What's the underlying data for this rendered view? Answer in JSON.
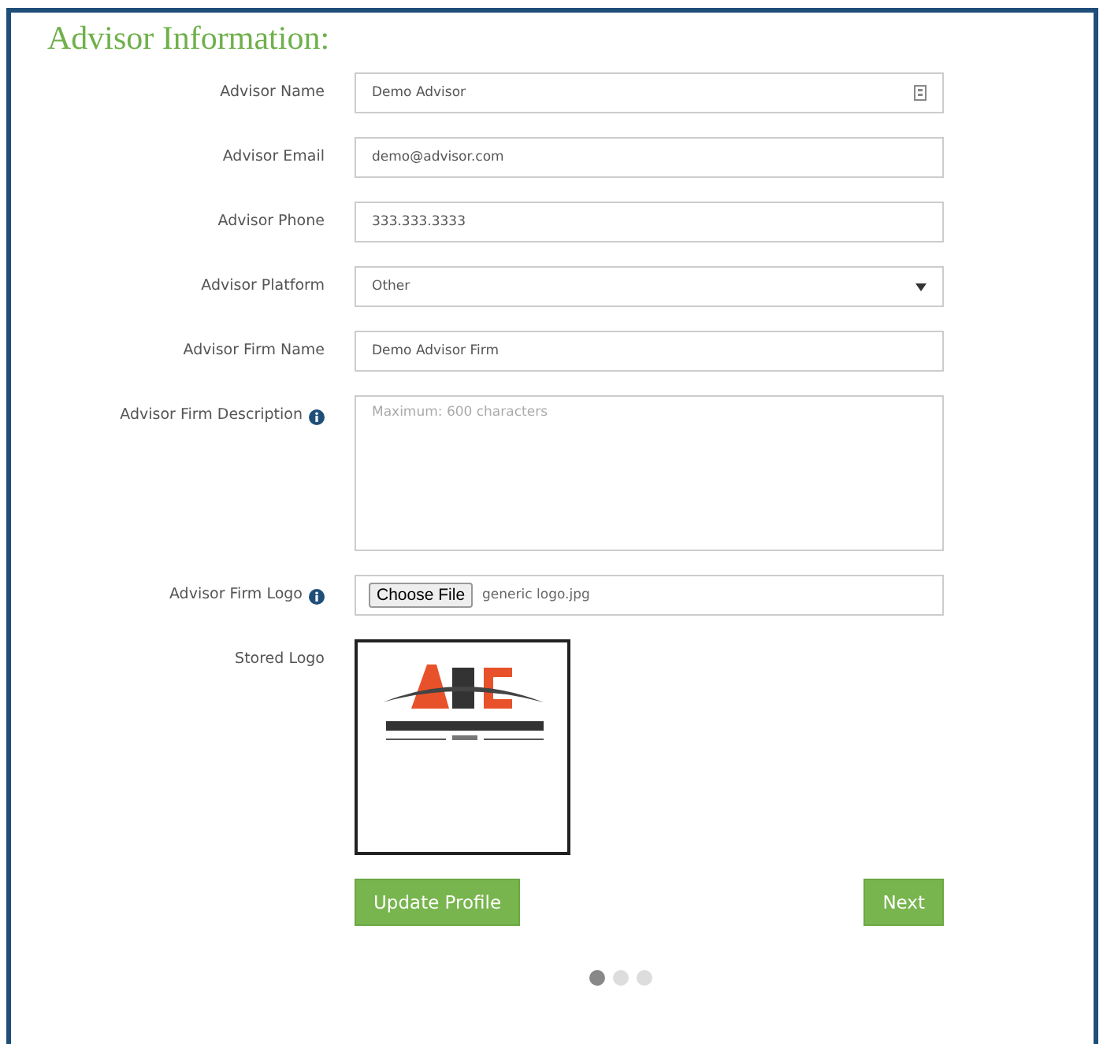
{
  "title": "Advisor Information:",
  "fields": [
    {
      "kind": "text",
      "label": "Advisor Name",
      "value": "Demo Advisor",
      "autofill_icon": true
    },
    {
      "kind": "text",
      "label": "Advisor Email",
      "value": "demo@advisor.com"
    },
    {
      "kind": "text",
      "label": "Advisor Phone",
      "value": "333.333.3333"
    },
    {
      "kind": "select",
      "label": "Advisor Platform",
      "value": "Other"
    },
    {
      "kind": "text",
      "label": "Advisor Firm Name",
      "value": "Demo Advisor Firm"
    },
    {
      "kind": "textarea",
      "label": "Advisor Firm Description",
      "info": true,
      "placeholder": "Maximum: 600 characters"
    },
    {
      "kind": "file",
      "label": "Advisor Firm Logo",
      "info": true,
      "button": "Choose File",
      "value": "generic logo.jpg"
    },
    {
      "label": "Stored Logo"
    }
  ],
  "buttons": [
    {
      "label": "Update Profile"
    },
    {
      "label": "Next"
    }
  ],
  "carousel_dots": [
    {
      "selected": true
    },
    {
      "selected": false
    },
    {
      "selected": false
    }
  ]
}
